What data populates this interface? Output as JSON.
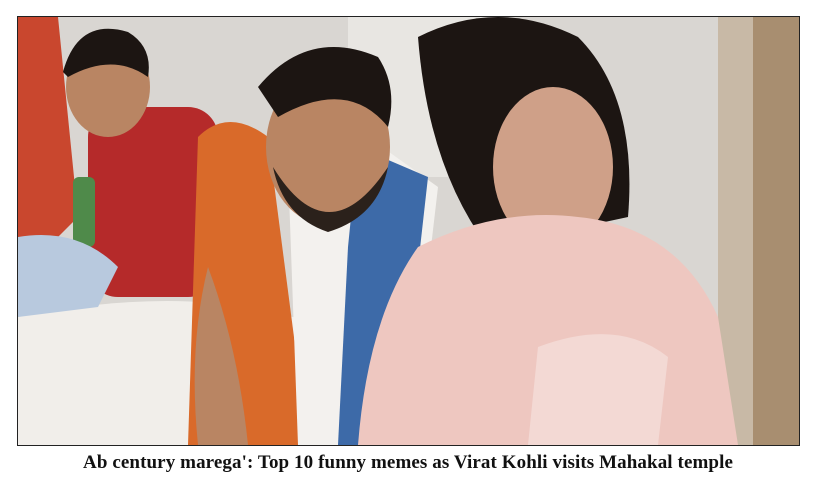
{
  "article": {
    "caption": "Ab century marega': Top 10 funny memes as Virat Kohli visits Mahakal temple"
  },
  "photo": {
    "palette": {
      "background_wall": "#d9d6d2",
      "curtain_orange": "#c9472e",
      "boy_shirt_red": "#b52a2a",
      "man_shawl_orange": "#d96a2a",
      "man_shawl_blue": "#3d6aa8",
      "woman_scarf_pink": "#eec7c0",
      "skin": "#b98563",
      "hair": "#1c1512",
      "white_cloth": "#f1eeea"
    }
  }
}
